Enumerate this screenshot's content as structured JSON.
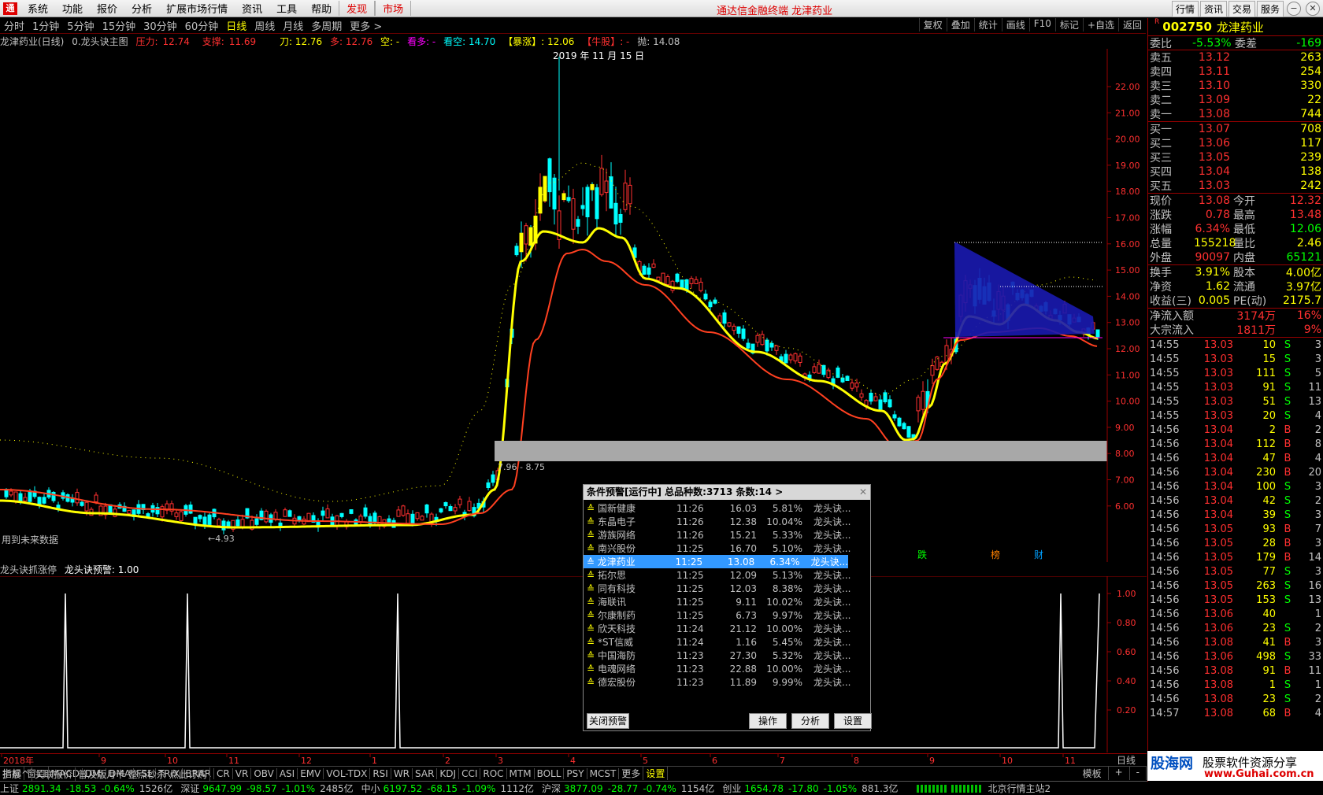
{
  "menu": {
    "items": [
      "系统",
      "功能",
      "报价",
      "分析",
      "扩展市场行情",
      "资讯",
      "工具",
      "帮助"
    ],
    "discover": "发现",
    "market": "市场",
    "app_title": "通达信金融终端  龙津药业",
    "right_buttons": [
      "行情",
      "资讯",
      "交易",
      "服务"
    ]
  },
  "periods": {
    "items": [
      "分时",
      "1分钟",
      "5分钟",
      "15分钟",
      "30分钟",
      "60分钟",
      "日线",
      "周线",
      "月线",
      "多周期",
      "更多 >"
    ],
    "active": "日线",
    "tools": [
      "复权",
      "叠加",
      "统计",
      "画线",
      "F10",
      "标记",
      "+自选",
      "返回"
    ]
  },
  "info": {
    "title": "龙津药业(日线)",
    "formula": "0.龙头诀主图",
    "pressure_label": "压力:",
    "pressure": "12.74",
    "support_label": "支撑:",
    "support": "11.69",
    "blade": "刀: 12.76",
    "duo": "多: 12.76",
    "kong": "空: -",
    "kanduo": "看多: -",
    "kankong": "看空: 14.70",
    "baozhang": "【暴涨】: 12.06",
    "niugu": "【牛股】: -",
    "pao": "抛: 14.08"
  },
  "chart": {
    "date_label": "2019 年 11 月 15 日",
    "box_label": "7.96 - 8.75",
    "low_label": "←4.93",
    "future_note": "用到未来数据",
    "price_ticks": [
      "22.00",
      "21.00",
      "20.00",
      "19.00",
      "18.00",
      "17.00",
      "16.00",
      "15.00",
      "14.00",
      "13.00",
      "12.00",
      "11.00",
      "10.00",
      "9.00",
      "8.00",
      "7.00",
      "6.00"
    ],
    "markers": [
      "跌",
      "榜",
      "财"
    ]
  },
  "sub": {
    "title": "龙头诀抓涨停",
    "value": "龙头诀预警: 1.00",
    "ticks": [
      "1.00",
      "0.80",
      "0.60",
      "0.40",
      "0.20"
    ]
  },
  "xaxis": {
    "labels": [
      "2018年",
      "9",
      "10",
      "11",
      "12",
      "1",
      "2",
      "3",
      "4",
      "5",
      "6",
      "7",
      "8",
      "9",
      "10",
      "11"
    ],
    "mode": "日线"
  },
  "tabs": [
    "指标",
    "窗口",
    "MACD",
    "DMI",
    "DMA",
    "FSL",
    "TRIX",
    "BRAR",
    "CR",
    "VR",
    "OBV",
    "ASI",
    "EMV",
    "VOL-TDX",
    "RSI",
    "WR",
    "SAR",
    "KDJ",
    "CCI",
    "ROC",
    "MTM",
    "BOLL",
    "PSY",
    "MCST",
    "更多",
    "设置"
  ],
  "tabs_right": [
    "模板",
    "+",
    "-"
  ],
  "tabs2": [
    "扩展^",
    "关联报价",
    "普及版月卡 整点秒杀 点此订购"
  ],
  "status": [
    {
      "name": "上证",
      "v": "2891.34",
      "c": "-18.53",
      "p": "-0.64%",
      "a": "1526亿"
    },
    {
      "name": "深证",
      "v": "9647.99",
      "c": "-98.57",
      "p": "-1.01%",
      "a": "2485亿"
    },
    {
      "name": "中小",
      "v": "6197.52",
      "c": "-68.15",
      "p": "-1.09%",
      "a": "1112亿"
    },
    {
      "name": "沪深",
      "v": "3877.09",
      "c": "-28.77",
      "p": "-0.74%",
      "a": "1154亿"
    },
    {
      "name": "创业",
      "v": "1654.78",
      "c": "-17.80",
      "p": "-1.05%",
      "a": "881.3亿"
    }
  ],
  "status_server": "北京行情主站2",
  "quote": {
    "code": "002750",
    "name": "龙津药业",
    "weibi_label": "委比",
    "weibi": "-5.53%",
    "weicha_label": "委差",
    "weicha": "-169",
    "asks": [
      [
        "卖五",
        "13.12",
        "263"
      ],
      [
        "卖四",
        "13.11",
        "254"
      ],
      [
        "卖三",
        "13.10",
        "330"
      ],
      [
        "卖二",
        "13.09",
        "22"
      ],
      [
        "卖一",
        "13.08",
        "744"
      ]
    ],
    "bids": [
      [
        "买一",
        "13.07",
        "708"
      ],
      [
        "买二",
        "13.06",
        "117"
      ],
      [
        "买三",
        "13.05",
        "239"
      ],
      [
        "买四",
        "13.04",
        "138"
      ],
      [
        "买五",
        "13.03",
        "242"
      ]
    ],
    "stats": [
      [
        "现价",
        "13.08",
        "今开",
        "12.32"
      ],
      [
        "涨跌",
        "0.78",
        "最高",
        "13.48"
      ],
      [
        "涨幅",
        "6.34%",
        "最低",
        "12.06"
      ],
      [
        "总量",
        "155218",
        "量比",
        "2.46"
      ],
      [
        "外盘",
        "90097",
        "内盘",
        "65121"
      ]
    ],
    "stats2": [
      [
        "换手",
        "3.91%",
        "股本",
        "4.00亿"
      ],
      [
        "净资",
        "1.62",
        "流通",
        "3.97亿"
      ],
      [
        "收益(三)",
        "0.005",
        "PE(动)",
        "2175.7"
      ]
    ],
    "flows": [
      [
        "净流入额",
        "3174万",
        "16%"
      ],
      [
        "大宗流入",
        "1811万",
        "9%"
      ]
    ],
    "ticks": [
      [
        "14:55",
        "13.03",
        "10",
        "S",
        "3"
      ],
      [
        "14:55",
        "13.03",
        "15",
        "S",
        "3"
      ],
      [
        "14:55",
        "13.03",
        "111",
        "S",
        "5"
      ],
      [
        "14:55",
        "13.03",
        "91",
        "S",
        "11"
      ],
      [
        "14:55",
        "13.03",
        "51",
        "S",
        "13"
      ],
      [
        "14:55",
        "13.03",
        "20",
        "S",
        "4"
      ],
      [
        "14:56",
        "13.04",
        "2",
        "B",
        "2"
      ],
      [
        "14:56",
        "13.04",
        "112",
        "B",
        "8"
      ],
      [
        "14:56",
        "13.04",
        "47",
        "B",
        "4"
      ],
      [
        "14:56",
        "13.04",
        "230",
        "B",
        "20"
      ],
      [
        "14:56",
        "13.04",
        "100",
        "S",
        "3"
      ],
      [
        "14:56",
        "13.04",
        "42",
        "S",
        "2"
      ],
      [
        "14:56",
        "13.04",
        "39",
        "S",
        "3"
      ],
      [
        "14:56",
        "13.05",
        "93",
        "B",
        "7"
      ],
      [
        "14:56",
        "13.05",
        "28",
        "B",
        "3"
      ],
      [
        "14:56",
        "13.05",
        "179",
        "B",
        "14"
      ],
      [
        "14:56",
        "13.05",
        "77",
        "S",
        "3"
      ],
      [
        "14:56",
        "13.05",
        "263",
        "S",
        "16"
      ],
      [
        "14:56",
        "13.05",
        "153",
        "S",
        "13"
      ],
      [
        "14:56",
        "13.06",
        "40",
        "",
        "1"
      ],
      [
        "14:56",
        "13.06",
        "23",
        "S",
        "2"
      ],
      [
        "14:56",
        "13.08",
        "41",
        "B",
        "3"
      ],
      [
        "14:56",
        "13.06",
        "498",
        "S",
        "33"
      ],
      [
        "14:56",
        "13.08",
        "91",
        "B",
        "11"
      ],
      [
        "14:56",
        "13.08",
        "1",
        "S",
        "1"
      ],
      [
        "14:56",
        "13.08",
        "23",
        "S",
        "2"
      ],
      [
        "14:57",
        "13.08",
        "68",
        "B",
        "4"
      ]
    ]
  },
  "alert": {
    "title": "条件预警[运行中] 总品种数:3713 条数:14  >",
    "rows": [
      [
        "国新健康",
        "11:26",
        "16.03",
        "5.81%",
        "龙头诀..."
      ],
      [
        "东晶电子",
        "11:26",
        "12.38",
        "10.04%",
        "龙头诀..."
      ],
      [
        "游族网络",
        "11:26",
        "15.21",
        "5.33%",
        "龙头诀..."
      ],
      [
        "南兴股份",
        "11:25",
        "16.70",
        "5.10%",
        "龙头诀..."
      ],
      [
        "龙津药业",
        "11:25",
        "13.08",
        "6.34%",
        "龙头诀..."
      ],
      [
        "拓尔思",
        "11:25",
        "12.09",
        "5.13%",
        "龙头诀..."
      ],
      [
        "同有科技",
        "11:25",
        "12.03",
        "8.38%",
        "龙头诀..."
      ],
      [
        "海联讯",
        "11:25",
        "9.11",
        "10.02%",
        "龙头诀..."
      ],
      [
        "尔康制药",
        "11:25",
        "6.73",
        "9.97%",
        "龙头诀..."
      ],
      [
        "欣天科技",
        "11:24",
        "21.12",
        "10.00%",
        "龙头诀..."
      ],
      [
        "*ST信威",
        "11:24",
        "1.16",
        "5.45%",
        "龙头诀..."
      ],
      [
        "中国海防",
        "11:23",
        "27.30",
        "5.32%",
        "龙头诀..."
      ],
      [
        "电魂网络",
        "11:23",
        "22.88",
        "10.00%",
        "龙头诀..."
      ],
      [
        "德宏股份",
        "11:23",
        "11.89",
        "9.99%",
        "龙头诀..."
      ]
    ],
    "selected": 4,
    "close_btn": "关闭预警",
    "op_btn": "操作",
    "analyze_btn": "分析",
    "settings_btn": "设置"
  },
  "watermark": {
    "logo": "股海网",
    "text": "股票软件资源分享",
    "url": "www.Guhai.com.cn"
  }
}
